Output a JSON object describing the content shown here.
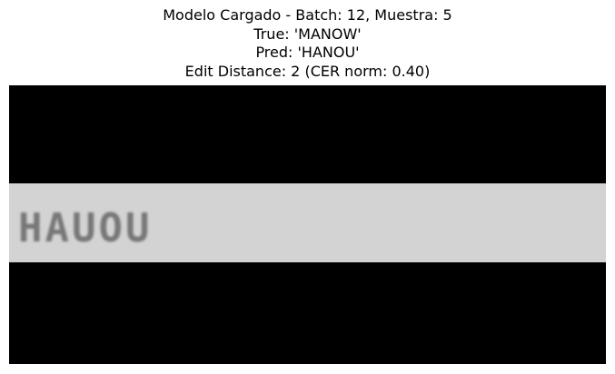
{
  "title": {
    "line1": "Modelo Cargado - Batch: 12, Muestra: 5",
    "line2": "True: 'MANOW'",
    "line3": "Pred: 'HANOU'",
    "line4": "Edit Distance: 2 (CER norm: 0.40)"
  },
  "sample_image": {
    "handwritten_text": "HAUOU",
    "background_color": "#000000",
    "band_color": "#d3d3d3"
  }
}
